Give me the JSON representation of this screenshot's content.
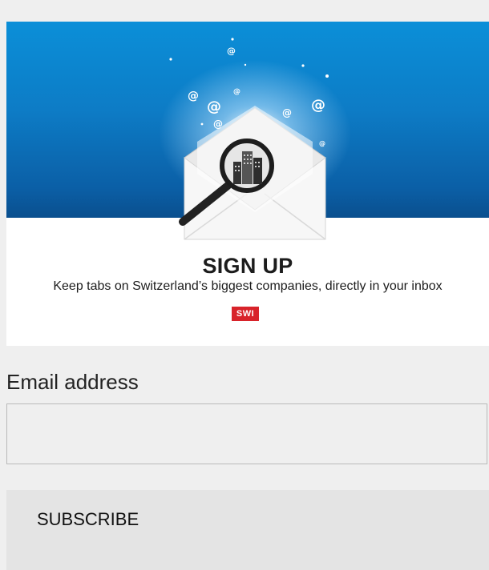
{
  "banner": {
    "title": "SIGN UP",
    "subtitle": "Keep tabs on Switzerland’s biggest companies, directly in your inbox",
    "badge": "SWI"
  },
  "form": {
    "email_label": "Email address",
    "email_value": "",
    "email_placeholder": "",
    "subscribe_label": "SUBSCRIBE"
  },
  "colors": {
    "sky_top": "#0b8fd8",
    "sky_bottom": "#0a4f8e",
    "badge_red": "#d8232a",
    "page_bg": "#efefef"
  },
  "icons": [
    "at-sign-icon",
    "envelope-icon",
    "magnifier-icon",
    "buildings-icon"
  ]
}
